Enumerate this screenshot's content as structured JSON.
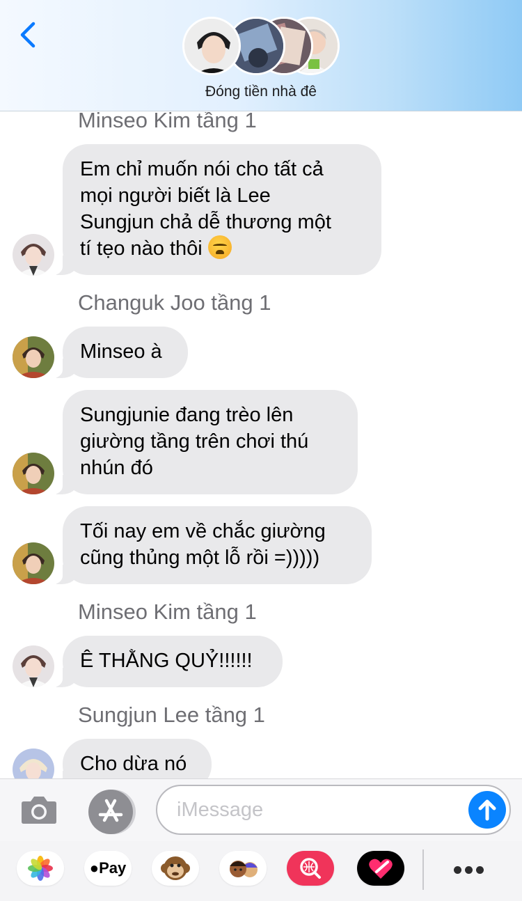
{
  "header": {
    "back_icon": "chevron-left-icon",
    "group_name": "Đóng tiền nhà đê",
    "participant_avatar_count": 4
  },
  "messages": [
    {
      "sender": "Minseo Kim tầng 1",
      "bubbles": [
        {
          "lines": [
            "Em chỉ muốn nói cho tất cả",
            "mọi người biết là Lee",
            "Sungjun chả dễ thương một",
            "tí tẹo nào thôi"
          ],
          "trailing_emoji": "face-with-steam-emoji"
        }
      ]
    },
    {
      "sender": "Changuk Joo tầng 1",
      "bubbles": [
        {
          "lines": [
            "Minseo à"
          ]
        },
        {
          "lines": [
            "Sungjunie đang trèo lên",
            "giường tầng trên chơi thú",
            "nhún đó"
          ]
        },
        {
          "lines": [
            "Tối nay em về chắc giường",
            "cũng thủng một lỗ rồi =)))))"
          ]
        }
      ]
    },
    {
      "sender": "Minseo Kim tầng 1",
      "bubbles": [
        {
          "lines": [
            "Ê THẰNG QUỶ!!!!!!"
          ]
        }
      ]
    },
    {
      "sender": "Sungjun Lee tầng 1",
      "bubbles": [
        {
          "lines": [
            "Cho dừa nó"
          ]
        }
      ]
    }
  ],
  "input_bar": {
    "camera_icon": "camera-icon",
    "app_store_icon": "app-store-icon",
    "placeholder": "iMessage",
    "send_icon": "arrow-up-icon"
  },
  "app_drawer": {
    "apps": [
      "photos-app-icon",
      "apple-pay-app-icon",
      "animoji-monkey-icon",
      "memoji-icon",
      "image-search-icon",
      "digital-touch-icon"
    ],
    "apple_pay_label": "Pay",
    "more_icon": "more-dots-icon"
  },
  "colors": {
    "accent": "#0a84ff",
    "bubble_received": "#e9e9eb",
    "sender_text": "#6e6e73"
  }
}
